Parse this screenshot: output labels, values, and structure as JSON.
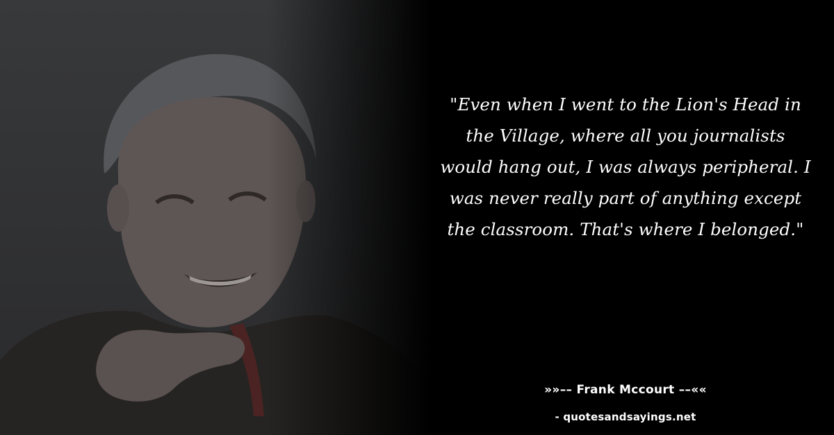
{
  "quote": {
    "text": "\"Even when I went to the Lion's Head in the Village, where all you journalists would hang out, I was always peripheral. I was never really part of anything except the classroom. That's where I belonged.\""
  },
  "author": {
    "line": "»»–– Frank Mccourt ––««"
  },
  "source": {
    "line": "- quotesandsayings.net"
  },
  "colors": {
    "background": "#000000",
    "text": "#ffffff"
  }
}
